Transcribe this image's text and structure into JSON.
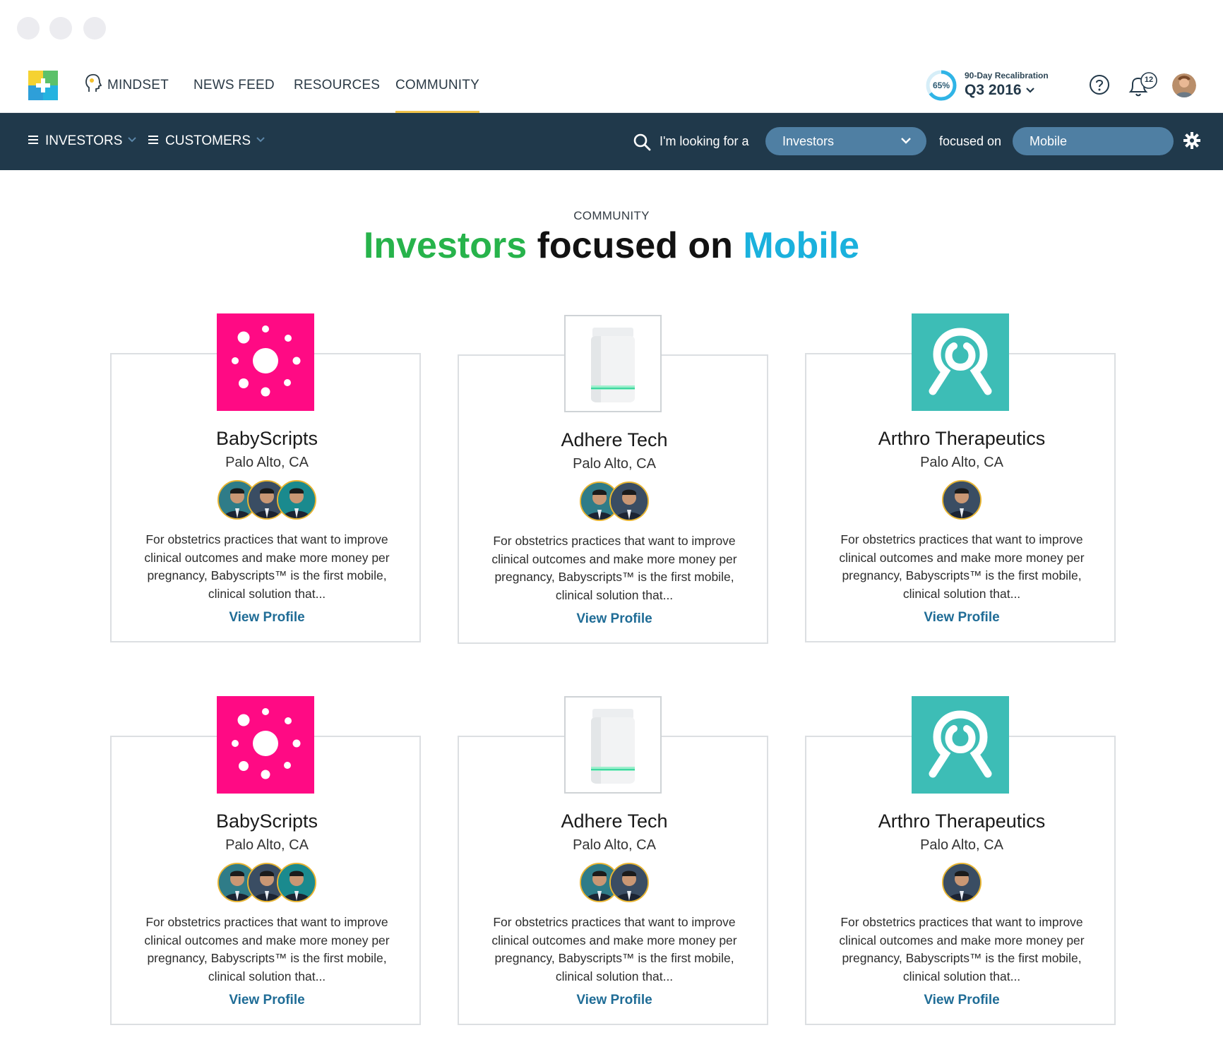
{
  "nav": {
    "items": [
      "MINDSET",
      "NEWS FEED",
      "RESOURCES",
      "COMMUNITY"
    ],
    "active": "COMMUNITY",
    "progress_percent": 65,
    "progress_label": "65%",
    "recalibration_label": "90-Day Recalibration",
    "recalibration_period": "Q3 2016",
    "notification_count": "12"
  },
  "subnav": {
    "menu_investors": "INVESTORS",
    "menu_customers": "CUSTOMERS",
    "looking_for_label": "I'm looking for a",
    "looking_for_value": "Investors",
    "focused_on_label": "focused on",
    "focused_on_value": "Mobile"
  },
  "heading": {
    "eyebrow": "COMMUNITY",
    "part1": "Investors",
    "part2": "focused on",
    "part3": "Mobile"
  },
  "colors": {
    "accent_green": "#27b34b",
    "accent_blue": "#1ab1dd",
    "navbar": "#20394b",
    "pill": "#4f7fa3",
    "link": "#1f6c96",
    "active_underline": "#f0c24a",
    "babyscripts_brand": "#ff0a84",
    "arthro_brand": "#3dbdb6"
  },
  "cards": [
    {
      "name": "BabyScripts",
      "location": "Palo Alto, CA",
      "logo": "babyscripts-logo",
      "investor_count": 3,
      "description": "For obstetrics practices that want to improve clinical outcomes and make more money per pregnancy, Babyscripts™ is the first mobile, clinical solution that...",
      "link": "View Profile"
    },
    {
      "name": "Adhere Tech",
      "location": "Palo Alto, CA",
      "logo": "pill-bottle-logo",
      "investor_count": 2,
      "description": "For obstetrics practices that want to improve clinical outcomes and make more money per pregnancy, Babyscripts™ is the first mobile, clinical solution that...",
      "link": "View Profile"
    },
    {
      "name": "Arthro Therapeutics",
      "location": "Palo Alto, CA",
      "logo": "arthro-logo",
      "investor_count": 1,
      "description": "For obstetrics practices that want to improve clinical outcomes and make more money per pregnancy, Babyscripts™ is the first mobile, clinical solution that...",
      "link": "View Profile"
    },
    {
      "name": "BabyScripts",
      "location": "Palo Alto, CA",
      "logo": "babyscripts-logo",
      "investor_count": 3,
      "description": "For obstetrics practices that want to improve clinical outcomes and make more money per pregnancy, Babyscripts™ is the first mobile, clinical solution that...",
      "link": "View Profile"
    },
    {
      "name": "Adhere Tech",
      "location": "Palo Alto, CA",
      "logo": "pill-bottle-logo",
      "investor_count": 2,
      "description": "For obstetrics practices that want to improve clinical outcomes and make more money per pregnancy, Babyscripts™ is the first mobile, clinical solution that...",
      "link": "View Profile"
    },
    {
      "name": "Arthro Therapeutics",
      "location": "Palo Alto, CA",
      "logo": "arthro-logo",
      "investor_count": 1,
      "description": "For obstetrics practices that want to improve clinical outcomes and make more money per pregnancy, Babyscripts™ is the first mobile, clinical solution that...",
      "link": "View Profile"
    }
  ]
}
